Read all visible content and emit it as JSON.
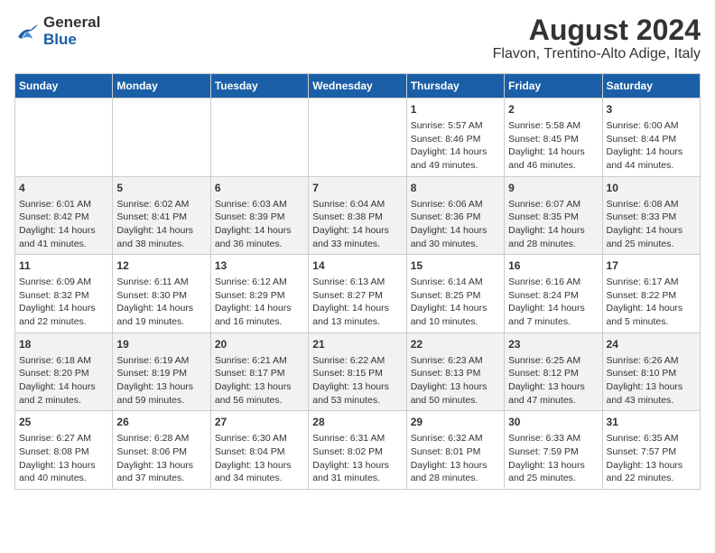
{
  "header": {
    "logo_line1": "General",
    "logo_line2": "Blue",
    "title": "August 2024",
    "subtitle": "Flavon, Trentino-Alto Adige, Italy"
  },
  "weekdays": [
    "Sunday",
    "Monday",
    "Tuesday",
    "Wednesday",
    "Thursday",
    "Friday",
    "Saturday"
  ],
  "weeks": [
    [
      {
        "day": "",
        "detail": ""
      },
      {
        "day": "",
        "detail": ""
      },
      {
        "day": "",
        "detail": ""
      },
      {
        "day": "",
        "detail": ""
      },
      {
        "day": "1",
        "detail": "Sunrise: 5:57 AM\nSunset: 8:46 PM\nDaylight: 14 hours and 49 minutes."
      },
      {
        "day": "2",
        "detail": "Sunrise: 5:58 AM\nSunset: 8:45 PM\nDaylight: 14 hours and 46 minutes."
      },
      {
        "day": "3",
        "detail": "Sunrise: 6:00 AM\nSunset: 8:44 PM\nDaylight: 14 hours and 44 minutes."
      }
    ],
    [
      {
        "day": "4",
        "detail": "Sunrise: 6:01 AM\nSunset: 8:42 PM\nDaylight: 14 hours and 41 minutes."
      },
      {
        "day": "5",
        "detail": "Sunrise: 6:02 AM\nSunset: 8:41 PM\nDaylight: 14 hours and 38 minutes."
      },
      {
        "day": "6",
        "detail": "Sunrise: 6:03 AM\nSunset: 8:39 PM\nDaylight: 14 hours and 36 minutes."
      },
      {
        "day": "7",
        "detail": "Sunrise: 6:04 AM\nSunset: 8:38 PM\nDaylight: 14 hours and 33 minutes."
      },
      {
        "day": "8",
        "detail": "Sunrise: 6:06 AM\nSunset: 8:36 PM\nDaylight: 14 hours and 30 minutes."
      },
      {
        "day": "9",
        "detail": "Sunrise: 6:07 AM\nSunset: 8:35 PM\nDaylight: 14 hours and 28 minutes."
      },
      {
        "day": "10",
        "detail": "Sunrise: 6:08 AM\nSunset: 8:33 PM\nDaylight: 14 hours and 25 minutes."
      }
    ],
    [
      {
        "day": "11",
        "detail": "Sunrise: 6:09 AM\nSunset: 8:32 PM\nDaylight: 14 hours and 22 minutes."
      },
      {
        "day": "12",
        "detail": "Sunrise: 6:11 AM\nSunset: 8:30 PM\nDaylight: 14 hours and 19 minutes."
      },
      {
        "day": "13",
        "detail": "Sunrise: 6:12 AM\nSunset: 8:29 PM\nDaylight: 14 hours and 16 minutes."
      },
      {
        "day": "14",
        "detail": "Sunrise: 6:13 AM\nSunset: 8:27 PM\nDaylight: 14 hours and 13 minutes."
      },
      {
        "day": "15",
        "detail": "Sunrise: 6:14 AM\nSunset: 8:25 PM\nDaylight: 14 hours and 10 minutes."
      },
      {
        "day": "16",
        "detail": "Sunrise: 6:16 AM\nSunset: 8:24 PM\nDaylight: 14 hours and 7 minutes."
      },
      {
        "day": "17",
        "detail": "Sunrise: 6:17 AM\nSunset: 8:22 PM\nDaylight: 14 hours and 5 minutes."
      }
    ],
    [
      {
        "day": "18",
        "detail": "Sunrise: 6:18 AM\nSunset: 8:20 PM\nDaylight: 14 hours and 2 minutes."
      },
      {
        "day": "19",
        "detail": "Sunrise: 6:19 AM\nSunset: 8:19 PM\nDaylight: 13 hours and 59 minutes."
      },
      {
        "day": "20",
        "detail": "Sunrise: 6:21 AM\nSunset: 8:17 PM\nDaylight: 13 hours and 56 minutes."
      },
      {
        "day": "21",
        "detail": "Sunrise: 6:22 AM\nSunset: 8:15 PM\nDaylight: 13 hours and 53 minutes."
      },
      {
        "day": "22",
        "detail": "Sunrise: 6:23 AM\nSunset: 8:13 PM\nDaylight: 13 hours and 50 minutes."
      },
      {
        "day": "23",
        "detail": "Sunrise: 6:25 AM\nSunset: 8:12 PM\nDaylight: 13 hours and 47 minutes."
      },
      {
        "day": "24",
        "detail": "Sunrise: 6:26 AM\nSunset: 8:10 PM\nDaylight: 13 hours and 43 minutes."
      }
    ],
    [
      {
        "day": "25",
        "detail": "Sunrise: 6:27 AM\nSunset: 8:08 PM\nDaylight: 13 hours and 40 minutes."
      },
      {
        "day": "26",
        "detail": "Sunrise: 6:28 AM\nSunset: 8:06 PM\nDaylight: 13 hours and 37 minutes."
      },
      {
        "day": "27",
        "detail": "Sunrise: 6:30 AM\nSunset: 8:04 PM\nDaylight: 13 hours and 34 minutes."
      },
      {
        "day": "28",
        "detail": "Sunrise: 6:31 AM\nSunset: 8:02 PM\nDaylight: 13 hours and 31 minutes."
      },
      {
        "day": "29",
        "detail": "Sunrise: 6:32 AM\nSunset: 8:01 PM\nDaylight: 13 hours and 28 minutes."
      },
      {
        "day": "30",
        "detail": "Sunrise: 6:33 AM\nSunset: 7:59 PM\nDaylight: 13 hours and 25 minutes."
      },
      {
        "day": "31",
        "detail": "Sunrise: 6:35 AM\nSunset: 7:57 PM\nDaylight: 13 hours and 22 minutes."
      }
    ]
  ]
}
